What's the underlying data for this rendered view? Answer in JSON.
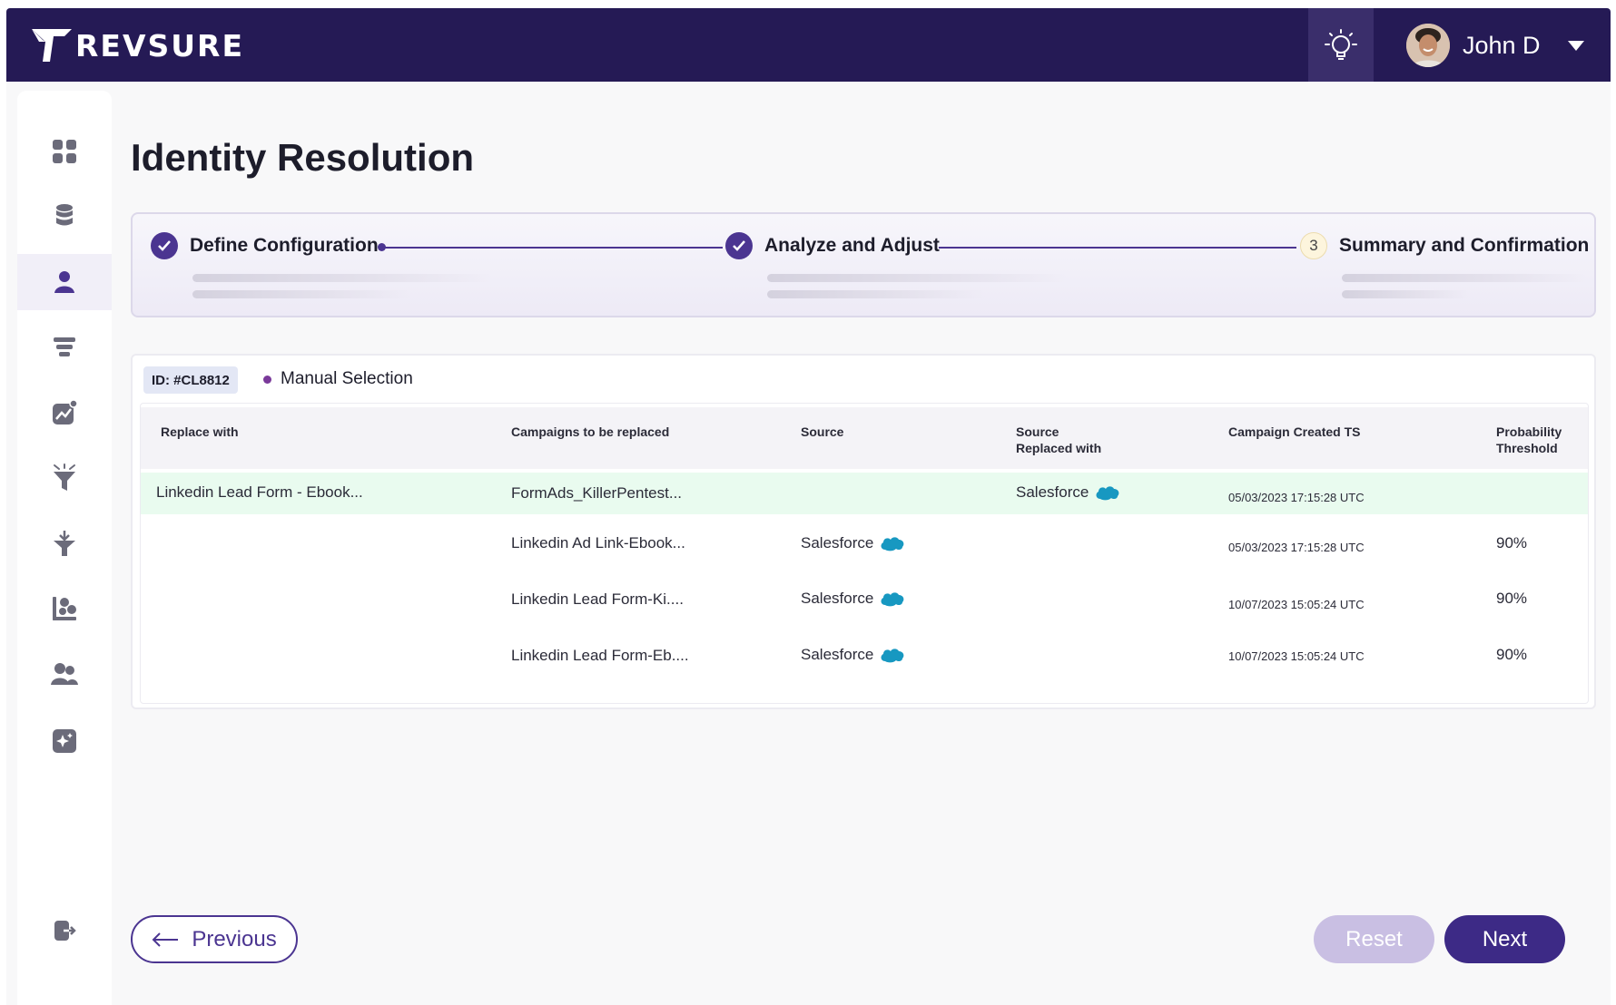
{
  "brand": {
    "name": "REVSURE"
  },
  "header": {
    "user_name": "John D",
    "icons": {
      "insights": "lightbulb-icon",
      "menu": "chevron-down-icon",
      "avatar": "user-avatar"
    }
  },
  "sidebar": {
    "items": [
      {
        "icon": "dashboard-grid-icon"
      },
      {
        "icon": "database-icon"
      },
      {
        "icon": "person-icon",
        "active": true
      },
      {
        "icon": "layers-icon"
      },
      {
        "icon": "analytics-chart-icon"
      },
      {
        "icon": "funnel-icon"
      },
      {
        "icon": "merge-arrow-icon"
      },
      {
        "icon": "segments-icon"
      },
      {
        "icon": "users-icon"
      },
      {
        "icon": "sparkle-icon"
      }
    ],
    "logout_icon": "logout-icon"
  },
  "page": {
    "title": "Identity Resolution"
  },
  "stepper": {
    "steps": [
      {
        "label": "Define Configuration",
        "status": "complete"
      },
      {
        "label": "Analyze and Adjust",
        "status": "complete"
      },
      {
        "label": "Summary and Confirmation",
        "status": "current",
        "number": "3"
      }
    ]
  },
  "record": {
    "id_label": "ID: #CL8812",
    "mode_label": "Manual Selection"
  },
  "table": {
    "headers": {
      "replace_with": "Replace with",
      "campaigns": "Campaigns to be replaced",
      "source": "Source",
      "source_replaced": "Source\nReplaced with",
      "created_ts": "Campaign Created TS",
      "probability": "Probability\nThreshold"
    },
    "rows": [
      {
        "replace_with": "Linkedin Lead Form - Ebook...",
        "campaign": "FormAds_KillerPentest...",
        "source": "",
        "source_replaced": "Salesforce",
        "created_ts": "05/03/2023 17:15:28 UTC",
        "probability": ""
      },
      {
        "replace_with": "",
        "campaign": "Linkedin Ad Link-Ebook...",
        "source": "Salesforce",
        "source_replaced": "",
        "created_ts": "05/03/2023 17:15:28 UTC",
        "probability": "90%"
      },
      {
        "replace_with": "",
        "campaign": "Linkedin Lead Form-Ki....",
        "source": "Salesforce",
        "source_replaced": "",
        "created_ts": "10/07/2023 15:05:24 UTC",
        "probability": "90%"
      },
      {
        "replace_with": "",
        "campaign": "Linkedin Lead Form-Eb....",
        "source": "Salesforce",
        "source_replaced": "",
        "created_ts": "10/07/2023 15:05:24 UTC",
        "probability": "90%"
      }
    ]
  },
  "actions": {
    "previous": "Previous",
    "reset": "Reset",
    "next": "Next"
  },
  "colors": {
    "brand_dark": "#251a55",
    "accent": "#4b3591",
    "highlight_row": "#e9fbef",
    "reset_disabled": "#c9bfe3",
    "next": "#3d2a86"
  }
}
